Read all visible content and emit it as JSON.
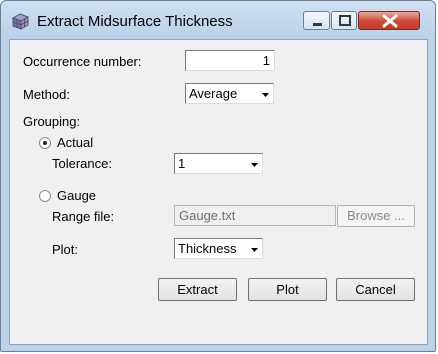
{
  "window": {
    "title": "Extract Midsurface Thickness",
    "icon": "grid-icon"
  },
  "form": {
    "occurrence_label": "Occurrence number:",
    "occurrence_value": "1",
    "method_label": "Method:",
    "method_value": "Average",
    "grouping_label": "Grouping:",
    "actual_label": "Actual",
    "actual_selected": true,
    "tolerance_label": "Tolerance:",
    "tolerance_value": "1",
    "gauge_label": "Gauge",
    "gauge_selected": false,
    "range_file_label": "Range file:",
    "range_file_value": "Gauge.txt",
    "browse_label": "Browse ...",
    "plot_label": "Plot:",
    "plot_value": "Thickness"
  },
  "buttons": {
    "extract": "Extract",
    "plot": "Plot",
    "cancel": "Cancel"
  }
}
